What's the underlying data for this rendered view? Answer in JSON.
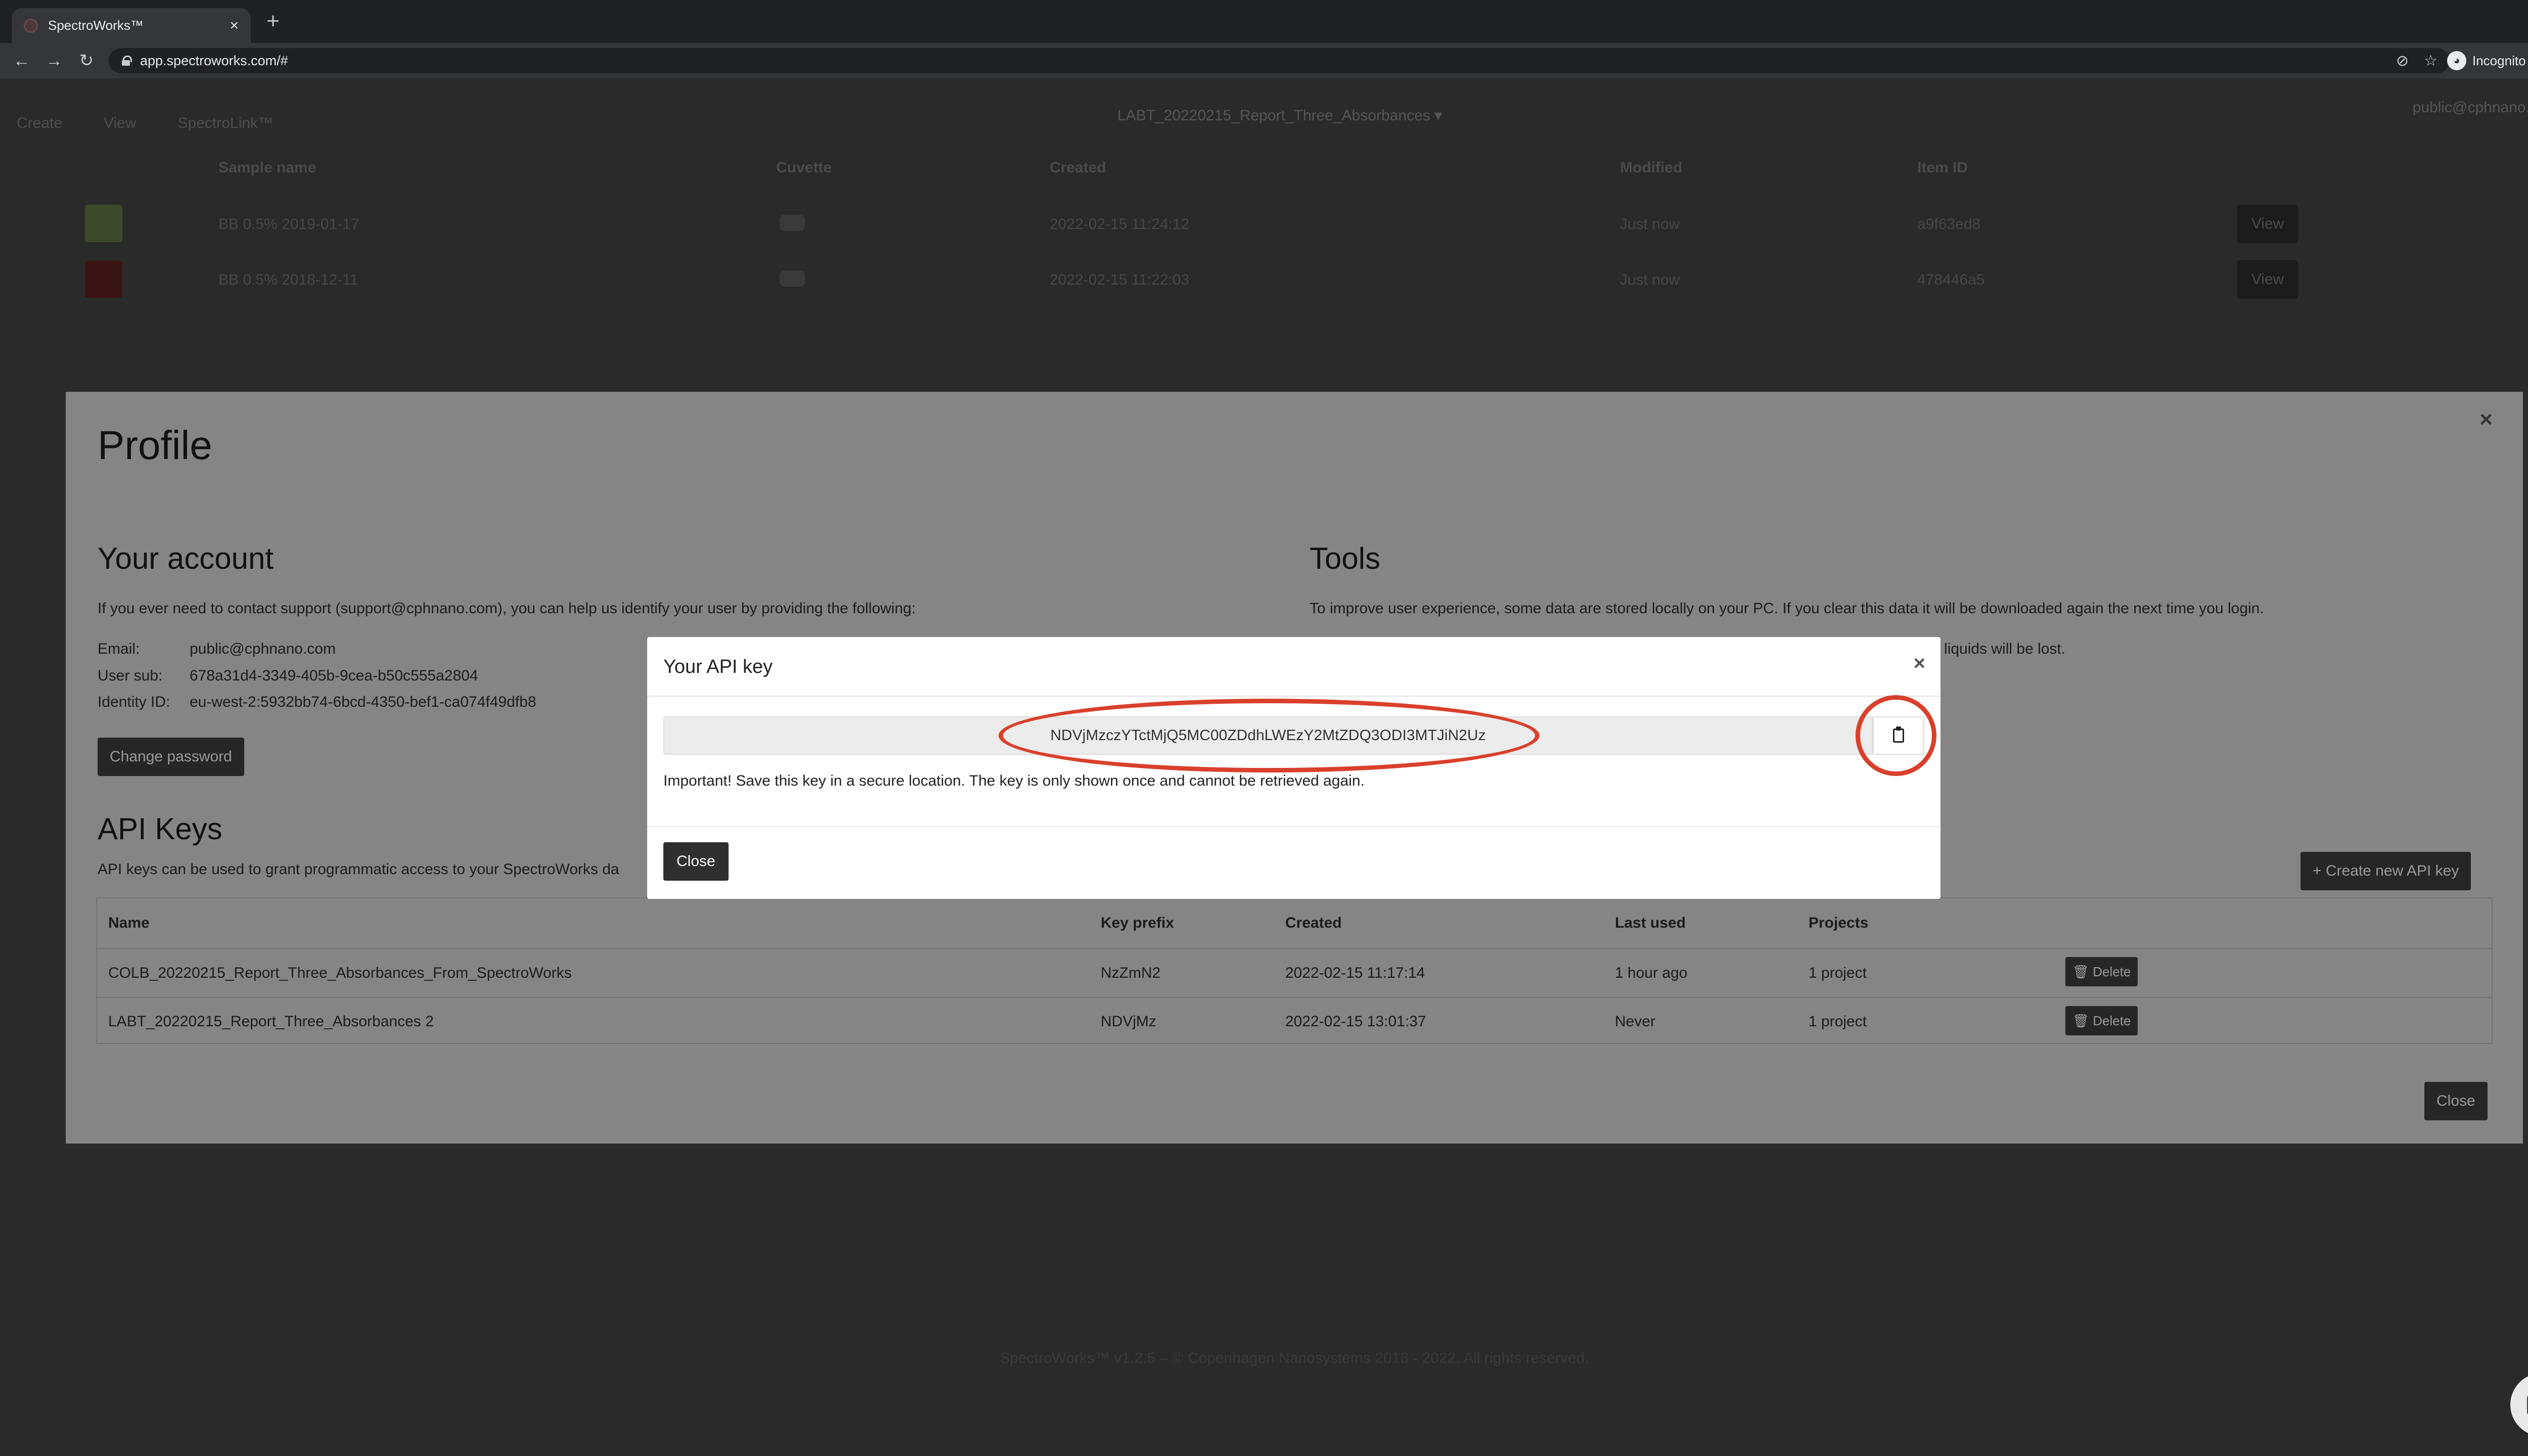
{
  "browser": {
    "tab_title": "SpectroWorks™",
    "url": "app.spectroworks.com/#",
    "incognito_label": "Incognito",
    "nav_icons": [
      "back-icon",
      "forward-icon",
      "reload-icon"
    ],
    "omnibox_icons": [
      "eye-off-icon",
      "star-icon"
    ]
  },
  "app": {
    "menu": [
      "Create",
      "View",
      "SpectroLink™"
    ],
    "project": "LABT_20220215_Report_Three_Absorbances ▾",
    "user": "public@cphnano.com ▾",
    "samples_table": {
      "headers": [
        "Sample name",
        "Cuvette",
        "Created",
        "Modified",
        "Item ID"
      ],
      "rows": [
        {
          "name": "BB 0.5% 2019-01-17",
          "created": "2022-02-15 11:24:12",
          "modified": "Just now",
          "item_id": "a9f63ed8",
          "view": "View",
          "thumb_color": "#3d4a2a"
        },
        {
          "name": "BB 0.5% 2018-12-11",
          "created": "2022-02-15 11:22:03",
          "modified": "Just now",
          "item_id": "478446a5",
          "view": "View",
          "thumb_color": "#3a1414"
        }
      ]
    },
    "footer": "SpectroWorks™ v1.2.5 – © Copenhagen Nanosystems 2018 - 2022. All rights reserved."
  },
  "profile": {
    "title": "Profile",
    "account": {
      "title": "Your account",
      "intro": "If you ever need to contact support (support@cphnano.com), you can help us identify your user by providing the following:",
      "email_label": "Email:",
      "email": "public@cphnano.com",
      "sub_label": "User sub:",
      "sub": "678a31d4-3349-405b-9cea-b50c555a2804",
      "identity_label": "Identity ID:",
      "identity": "eu-west-2:5932bb74-6bcd-4350-bef1-ca074f49dfb8",
      "change_password": "Change password"
    },
    "tools": {
      "title": "Tools",
      "text": "To improve user experience, some data are stored locally on your PC. If you clear this data it will be downloaded again the next time you login.",
      "text2": "liquids will be lost."
    },
    "api_keys": {
      "title": "API Keys",
      "intro": "API keys can be used to grant programmatic access to your SpectroWorks da",
      "create_button": "+  Create new API key",
      "headers": [
        "Name",
        "Key prefix",
        "Created",
        "Last used",
        "Projects"
      ],
      "rows": [
        {
          "name": "COLB_20220215_Report_Three_Absorbances_From_SpectroWorks",
          "prefix": "NzZmN2",
          "created": "2022-02-15 11:17:14",
          "last_used": "1 hour ago",
          "projects": "1 project",
          "delete": "Delete"
        },
        {
          "name": "LABT_20220215_Report_Three_Absorbances 2",
          "prefix": "NDVjMz",
          "created": "2022-02-15 13:01:37",
          "last_used": "Never",
          "projects": "1 project",
          "delete": "Delete"
        }
      ]
    },
    "close": "Close"
  },
  "api_key_dialog": {
    "title": "Your API key",
    "key": "NDVjMzczYTctMjQ5MC00ZDdhLWEzY2MtZDQ3ODI3MTJiN2Uz",
    "note": "Important! Save this key in a secure location. The key is only shown once and cannot be retrieved again.",
    "close": "Close",
    "annotation_color": "#d9402b"
  }
}
